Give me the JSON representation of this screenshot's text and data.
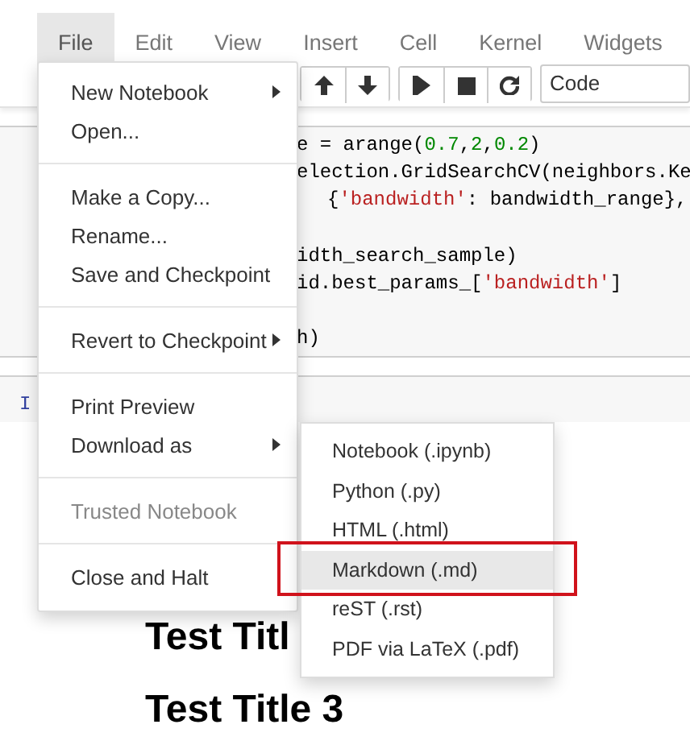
{
  "menubar": [
    {
      "label": "File",
      "selected": true
    },
    {
      "label": "Edit",
      "selected": false
    },
    {
      "label": "View",
      "selected": false
    },
    {
      "label": "Insert",
      "selected": false
    },
    {
      "label": "Cell",
      "selected": false
    },
    {
      "label": "Kernel",
      "selected": false
    },
    {
      "label": "Widgets",
      "selected": false
    }
  ],
  "toolbar": {
    "buttons": [
      {
        "kind": "up"
      },
      {
        "kind": "down"
      },
      {
        "kind": "run"
      },
      {
        "kind": "stop"
      },
      {
        "kind": "restart"
      }
    ],
    "cell_type": "Code"
  },
  "code_lines": [
    {
      "kind": "code",
      "segments": [
        {
          "kind": "plain",
          "text": "e = arange("
        },
        {
          "kind": "number",
          "text": "0.7"
        },
        {
          "kind": "plain",
          "text": ","
        },
        {
          "kind": "number",
          "text": "2"
        },
        {
          "kind": "plain",
          "text": ","
        },
        {
          "kind": "number",
          "text": "0.2"
        },
        {
          "kind": "plain",
          "text": ")"
        }
      ]
    },
    {
      "kind": "code",
      "segments": [
        {
          "kind": "plain",
          "text": "election.GridSearchCV(neighbors.Ke"
        }
      ]
    },
    {
      "kind": "continuation",
      "segments": [
        {
          "kind": "plain",
          "text": "{"
        },
        {
          "kind": "string",
          "text": "'bandwidth'"
        },
        {
          "kind": "plain",
          "text": ": bandwidth_range},"
        }
      ]
    },
    {
      "kind": "blank"
    },
    {
      "kind": "code",
      "segments": [
        {
          "kind": "plain",
          "text": "idth_search_sample)"
        }
      ]
    },
    {
      "kind": "code",
      "segments": [
        {
          "kind": "plain",
          "text": "id.best_params_["
        },
        {
          "kind": "string",
          "text": "'bandwidth'"
        },
        {
          "kind": "plain",
          "text": "]"
        }
      ]
    },
    {
      "kind": "blank"
    },
    {
      "kind": "code",
      "segments": [
        {
          "kind": "plain",
          "text": "h)"
        }
      ]
    }
  ],
  "next_cell": {
    "prompt": "I"
  },
  "headings": [
    {
      "text": "Test Titl"
    },
    {
      "text": "Test Title 3"
    }
  ],
  "file_menu": [
    {
      "kind": "submenu",
      "label": "New Notebook",
      "disabled": false
    },
    {
      "kind": "item",
      "label": "Open...",
      "disabled": false
    },
    {
      "kind": "divider"
    },
    {
      "kind": "item",
      "label": "Make a Copy...",
      "disabled": false
    },
    {
      "kind": "item",
      "label": "Rename...",
      "disabled": false
    },
    {
      "kind": "item",
      "label": "Save and Checkpoint",
      "disabled": false
    },
    {
      "kind": "divider"
    },
    {
      "kind": "submenu",
      "label": "Revert to Checkpoint",
      "disabled": false
    },
    {
      "kind": "divider"
    },
    {
      "kind": "item",
      "label": "Print Preview",
      "disabled": false
    },
    {
      "kind": "submenu",
      "label": "Download as",
      "disabled": false
    },
    {
      "kind": "divider"
    },
    {
      "kind": "item",
      "label": "Trusted Notebook",
      "disabled": true
    },
    {
      "kind": "divider"
    },
    {
      "kind": "item",
      "label": "Close and Halt",
      "disabled": false
    }
  ],
  "download_submenu": [
    {
      "label": "Notebook (.ipynb)",
      "selected": false
    },
    {
      "label": "Python (.py)",
      "selected": false
    },
    {
      "label": "HTML (.html)",
      "selected": false
    },
    {
      "label": "Markdown (.md)",
      "selected": true
    },
    {
      "label": "reST (.rst)",
      "selected": false
    },
    {
      "label": "PDF via LaTeX (.pdf)",
      "selected": false
    }
  ],
  "annotations": [
    {
      "kind": "box",
      "color": "#d0121b"
    }
  ]
}
